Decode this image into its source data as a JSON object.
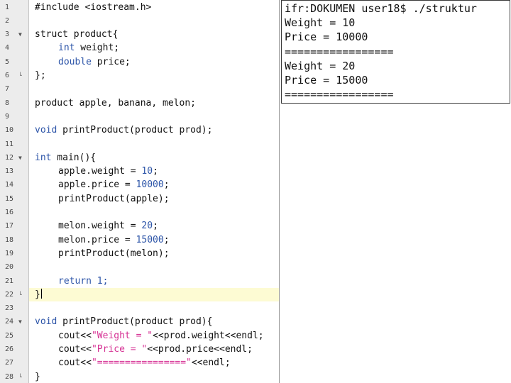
{
  "editor": {
    "current_line": 22,
    "lines": [
      {
        "n": "1"
      },
      {
        "n": "2"
      },
      {
        "n": "3"
      },
      {
        "n": "4"
      },
      {
        "n": "5"
      },
      {
        "n": "6"
      },
      {
        "n": "7"
      },
      {
        "n": "8"
      },
      {
        "n": "9"
      },
      {
        "n": "10"
      },
      {
        "n": "11"
      },
      {
        "n": "12"
      },
      {
        "n": "13"
      },
      {
        "n": "14"
      },
      {
        "n": "15"
      },
      {
        "n": "16"
      },
      {
        "n": "17"
      },
      {
        "n": "18"
      },
      {
        "n": "19"
      },
      {
        "n": "20"
      },
      {
        "n": "21"
      },
      {
        "n": "22"
      },
      {
        "n": "23"
      },
      {
        "n": "24"
      },
      {
        "n": "25"
      },
      {
        "n": "26"
      },
      {
        "n": "27"
      },
      {
        "n": "28"
      }
    ],
    "code": {
      "l1": "#include <iostream.h>",
      "l3": "struct product{",
      "l4_kw": "int",
      "l4_rest": " weight;",
      "l5_kw": "double",
      "l5_rest": " price;",
      "l6": "};",
      "l8": "product apple, banana, melon;",
      "l10_kw": "void",
      "l10_rest": " printProduct(product prod);",
      "l12_kw": "int",
      "l12_rest": " main(){",
      "l13_a": "apple.weight = ",
      "l13_num": "10",
      "l13_b": ";",
      "l14_a": "apple.price = ",
      "l14_num": "10000",
      "l14_b": ";",
      "l15": "printProduct(apple);",
      "l17_a": "melon.weight = ",
      "l17_num": "20",
      "l17_b": ";",
      "l18_a": "melon.price = ",
      "l18_num": "15000",
      "l18_b": ";",
      "l19": "printProduct(melon);",
      "l21": "return 1;",
      "l22": "}",
      "l24_kw": "void",
      "l24_rest": " printProduct(product prod){",
      "l25_a": "cout<<",
      "l25_str": "\"Weight = \"",
      "l25_b": "<<prod.weight<<endl;",
      "l26_a": "cout<<",
      "l26_str": "\"Price = \"",
      "l26_b": "<<prod.price<<endl;",
      "l27_a": "cout<<",
      "l27_str": "\"================\"",
      "l27_b": "<<endl;",
      "l28": "}"
    }
  },
  "terminal": {
    "lines": [
      "ifr:DOKUMEN user18$ ./struktur",
      "Weight = 10",
      "Price = 10000",
      "=================",
      "Weight = 20",
      "Price = 15000",
      "================="
    ]
  },
  "colors": {
    "keyword": "#2c54a8",
    "string": "#d63194",
    "current_line": "#fdfbd3",
    "gutter": "#ececec"
  }
}
